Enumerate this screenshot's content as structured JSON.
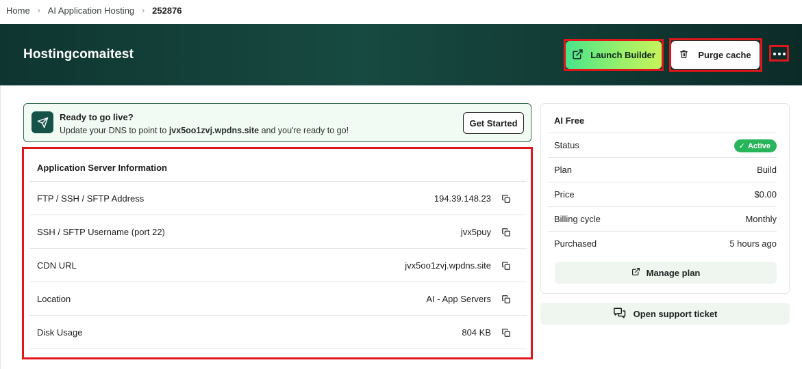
{
  "breadcrumb": {
    "items": [
      "Home",
      "AI Application Hosting",
      "252876"
    ]
  },
  "header": {
    "title": "Hostingcomaitest",
    "launch_label": "Launch Builder",
    "purge_label": "Purge cache"
  },
  "golive": {
    "title": "Ready to go live?",
    "text_before": "Update your DNS to point to ",
    "domain": "jvx5oo1zvj.wpdns.site",
    "text_after": " and you're ready to go!",
    "button_label": "Get Started"
  },
  "server_info": {
    "heading": "Application Server Information",
    "rows": [
      {
        "label": "FTP / SSH / SFTP Address",
        "value": "194.39.148.23"
      },
      {
        "label": "SSH / SFTP Username (port 22)",
        "value": "jvx5puy"
      },
      {
        "label": "CDN URL",
        "value": "jvx5oo1zvj.wpdns.site"
      },
      {
        "label": "Location",
        "value": "AI - App Servers"
      },
      {
        "label": "Disk Usage",
        "value": "804 KB"
      }
    ]
  },
  "plan": {
    "title": "AI Free",
    "status_label": "Status",
    "status_value": "Active",
    "rows": [
      {
        "label": "Plan",
        "value": "Build"
      },
      {
        "label": "Price",
        "value": "$0.00"
      },
      {
        "label": "Billing cycle",
        "value": "Monthly"
      },
      {
        "label": "Purchased",
        "value": "5 hours ago"
      }
    ],
    "manage_label": "Manage plan"
  },
  "support": {
    "label": "Open support ticket"
  },
  "colors": {
    "header_dark": "#0f3530",
    "accent_green": "#47e48a",
    "active_badge": "#28b45a",
    "highlight_red": "#e0161b"
  }
}
